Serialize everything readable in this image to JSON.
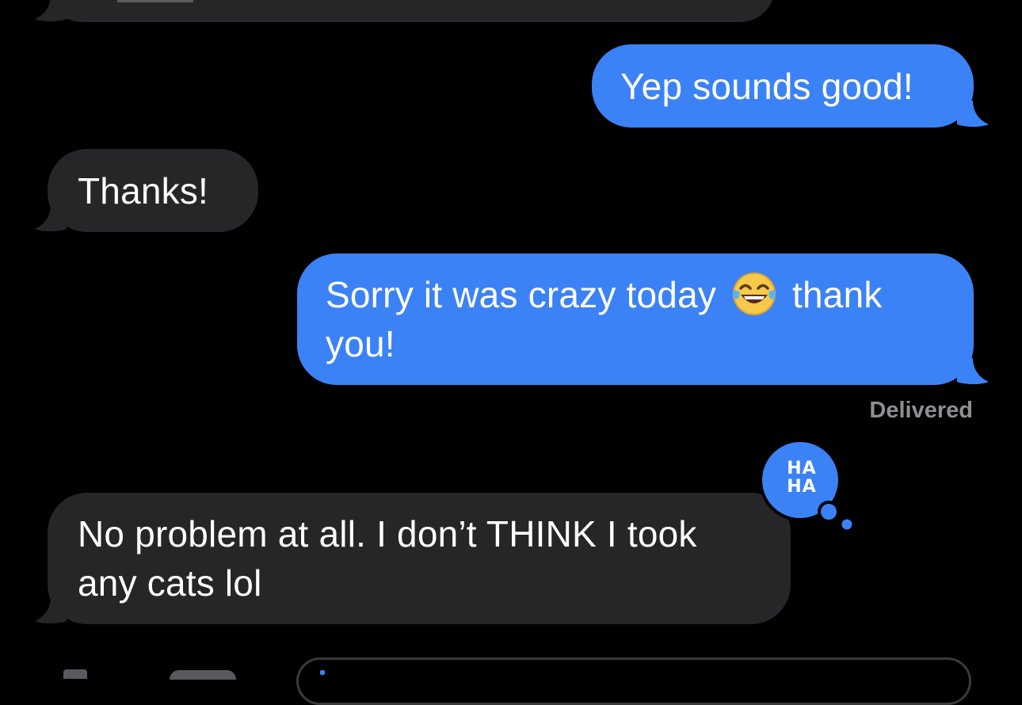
{
  "colors": {
    "background": "#000000",
    "incoming_bubble": "#262628",
    "outgoing_bubble": "#3b82f6",
    "meta_text": "#8e8e93"
  },
  "messages": [
    {
      "direction": "outgoing",
      "text": "Yep sounds good!"
    },
    {
      "direction": "incoming",
      "text": "Thanks!"
    },
    {
      "direction": "outgoing",
      "text_before_emoji": "Sorry it was crazy today",
      "emoji": "face-with-tears-of-joy-icon",
      "text_after_emoji": "thank",
      "text_line2": "you!"
    },
    {
      "direction": "incoming",
      "line1": "No problem at all. I don’t THINK I took",
      "line2": "any cats lol"
    }
  ],
  "status": {
    "delivered": "Delivered"
  },
  "reaction": {
    "label": "HA\nHA",
    "icon": "haha-reaction-icon"
  },
  "composer": {
    "camera_icon": "camera-icon",
    "apps_icon": "apps-icon"
  }
}
